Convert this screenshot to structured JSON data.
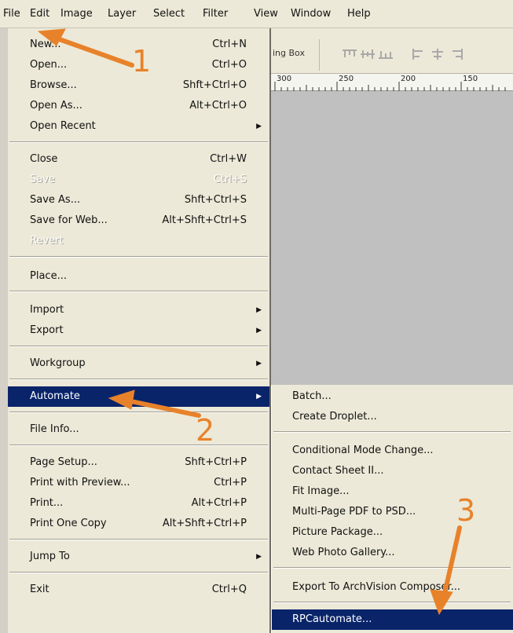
{
  "menubar": {
    "items": [
      {
        "label": "File"
      },
      {
        "label": "Edit"
      },
      {
        "label": "Image"
      },
      {
        "label": "Layer"
      },
      {
        "label": "Select"
      },
      {
        "label": "Filter"
      },
      {
        "label": "View"
      },
      {
        "label": "Window"
      },
      {
        "label": "Help"
      }
    ]
  },
  "options_bar": {
    "bounding_box_label": "ing Box"
  },
  "ruler": {
    "labels": [
      "300",
      "250",
      "200",
      "150"
    ]
  },
  "file_menu": {
    "items": [
      {
        "label": "New...",
        "shortcut": "Ctrl+N"
      },
      {
        "label": "Open...",
        "shortcut": "Ctrl+O"
      },
      {
        "label": "Browse...",
        "shortcut": "Shft+Ctrl+O"
      },
      {
        "label": "Open As...",
        "shortcut": "Alt+Ctrl+O"
      },
      {
        "label": "Open Recent",
        "shortcut": ""
      },
      {
        "label": "Close",
        "shortcut": "Ctrl+W"
      },
      {
        "label": "Save",
        "shortcut": "Ctrl+S"
      },
      {
        "label": "Save As...",
        "shortcut": "Shft+Ctrl+S"
      },
      {
        "label": "Save for Web...",
        "shortcut": "Alt+Shft+Ctrl+S"
      },
      {
        "label": "Revert",
        "shortcut": ""
      },
      {
        "label": "Place...",
        "shortcut": ""
      },
      {
        "label": "Import",
        "shortcut": ""
      },
      {
        "label": "Export",
        "shortcut": ""
      },
      {
        "label": "Workgroup",
        "shortcut": ""
      },
      {
        "label": "Automate",
        "shortcut": ""
      },
      {
        "label": "File Info...",
        "shortcut": ""
      },
      {
        "label": "Page Setup...",
        "shortcut": "Shft+Ctrl+P"
      },
      {
        "label": "Print with Preview...",
        "shortcut": "Ctrl+P"
      },
      {
        "label": "Print...",
        "shortcut": "Alt+Ctrl+P"
      },
      {
        "label": "Print One Copy",
        "shortcut": "Alt+Shft+Ctrl+P"
      },
      {
        "label": "Jump To",
        "shortcut": ""
      },
      {
        "label": "Exit",
        "shortcut": "Ctrl+Q"
      }
    ]
  },
  "automate_submenu": {
    "items": [
      {
        "label": "Batch..."
      },
      {
        "label": "Create Droplet..."
      },
      {
        "label": "Conditional Mode Change..."
      },
      {
        "label": "Contact Sheet II..."
      },
      {
        "label": "Fit Image..."
      },
      {
        "label": "Multi-Page PDF to PSD..."
      },
      {
        "label": "Picture Package..."
      },
      {
        "label": "Web Photo Gallery..."
      },
      {
        "label": "Export To ArchVision Composer..."
      },
      {
        "label": "RPCautomate..."
      }
    ]
  },
  "annotations": {
    "step_1": "1",
    "step_2": "2",
    "step_3": "3"
  },
  "colors": {
    "menu_background": "#ece9d8",
    "highlight": "#0a246a",
    "canvas": "#c0c0c0",
    "annotation_orange": "#e8822a"
  }
}
